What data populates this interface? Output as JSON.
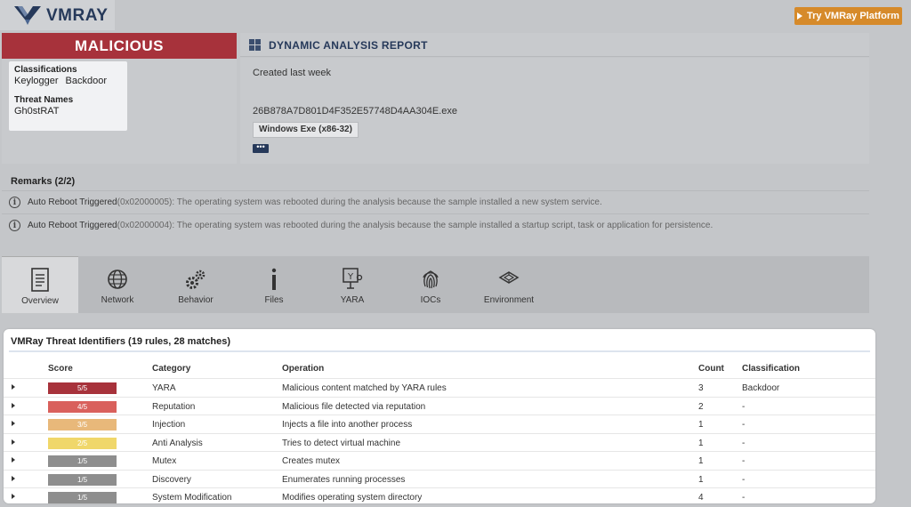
{
  "brand": {
    "name": "VMRAY",
    "cta": "Try VMRay Platform"
  },
  "verdict": {
    "label": "MALICIOUS",
    "color": "#a7323b"
  },
  "classifications": {
    "header": "Classifications",
    "items": [
      "Keylogger",
      "Backdoor"
    ],
    "threat_header": "Threat Names",
    "threat_name": "Gh0stRAT"
  },
  "report": {
    "os_icon": "windows-icon",
    "title": "DYNAMIC ANALYSIS REPORT",
    "created": "Created last week",
    "hash": "26B878A7D801D4F352E57748D4AA304E.exe",
    "file_type": "Windows Exe (x86-32)",
    "more": "•••"
  },
  "remarks": {
    "title": "Remarks (2/2)",
    "items": [
      {
        "name": "Auto Reboot Triggered",
        "code": " (0x02000005)",
        "text": ": The operating system was rebooted during the analysis because the sample installed a new system service."
      },
      {
        "name": "Auto Reboot Triggered",
        "code": " (0x02000004)",
        "text": ": The operating system was rebooted during the analysis because the sample installed a startup script, task or application for persistence."
      }
    ]
  },
  "tabs": [
    {
      "label": "Overview",
      "icon": "document-icon",
      "active": true
    },
    {
      "label": "Network",
      "icon": "globe-icon"
    },
    {
      "label": "Behavior",
      "icon": "gears-icon"
    },
    {
      "label": "Files",
      "icon": "info-icon"
    },
    {
      "label": "YARA",
      "icon": "yara-icon"
    },
    {
      "label": "IOCs",
      "icon": "fingerprint-icon"
    },
    {
      "label": "Environment",
      "icon": "cube-icon"
    }
  ],
  "threat_identifiers": {
    "title": "VMRay Threat Identifiers (19 rules, 28 matches)",
    "columns": {
      "score": "Score",
      "category": "Category",
      "operation": "Operation",
      "count": "Count",
      "classification": "Classification"
    },
    "rows": [
      {
        "score": "5/5",
        "color": "#a7323b",
        "category": "YARA",
        "operation": "Malicious content matched by YARA rules",
        "count": "3",
        "classification": "Backdoor"
      },
      {
        "score": "4/5",
        "color": "#d9605c",
        "category": "Reputation",
        "operation": "Malicious file detected via reputation",
        "count": "2",
        "classification": "-"
      },
      {
        "score": "3/5",
        "color": "#e8b87a",
        "category": "Injection",
        "operation": "Injects a file into another process",
        "count": "1",
        "classification": "-"
      },
      {
        "score": "2/5",
        "color": "#f0d76a",
        "category": "Anti Analysis",
        "operation": "Tries to detect virtual machine",
        "count": "1",
        "classification": "-"
      },
      {
        "score": "1/5",
        "color": "#8e8e8e",
        "category": "Mutex",
        "operation": "Creates mutex",
        "count": "1",
        "classification": "-"
      },
      {
        "score": "1/5",
        "color": "#8e8e8e",
        "category": "Discovery",
        "operation": "Enumerates running processes",
        "count": "1",
        "classification": "-"
      },
      {
        "score": "1/5",
        "color": "#8e8e8e",
        "category": "System Modification",
        "operation": "Modifies operating system directory",
        "count": "4",
        "classification": "-"
      }
    ]
  }
}
